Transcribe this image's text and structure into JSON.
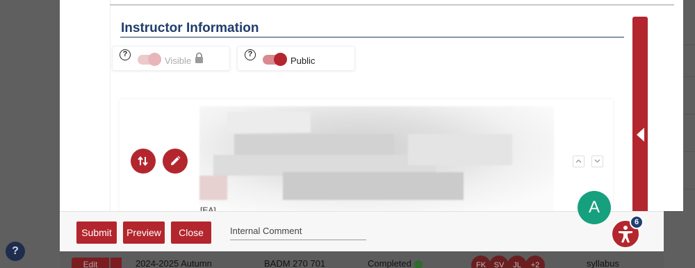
{
  "section": {
    "title": "Instructor Information"
  },
  "toggles": [
    {
      "label": "Visible",
      "state": "off",
      "locked": true
    },
    {
      "label": "Public",
      "state": "on",
      "locked": false
    }
  ],
  "content": {
    "partial_text": "[EA]"
  },
  "footer": {
    "submit_label": "Submit",
    "preview_label": "Preview",
    "close_label": "Close",
    "comment_placeholder": "Internal Comment"
  },
  "floating": {
    "a_badge": "A",
    "accessibility_count": "6"
  },
  "background_row": {
    "edit_label": "Edit",
    "term": "2024-2025 Autumn",
    "course": "BADM 270 701",
    "status": "Completed",
    "avatars": [
      "FK",
      "SV",
      "JL",
      "+2"
    ],
    "doc_type": "syllabus"
  },
  "help_label": "?",
  "colors": {
    "accent": "#b3262d",
    "title": "#1f3d6b",
    "badge_green": "#17a07d",
    "count_blue": "#1e3e73"
  },
  "icons": [
    "help-circle-icon",
    "lock-icon",
    "swap-vertical-icon",
    "pencil-icon",
    "chevron-up-icon",
    "chevron-down-icon",
    "collapse-left-icon",
    "accessibility-icon",
    "check-circle-icon"
  ]
}
